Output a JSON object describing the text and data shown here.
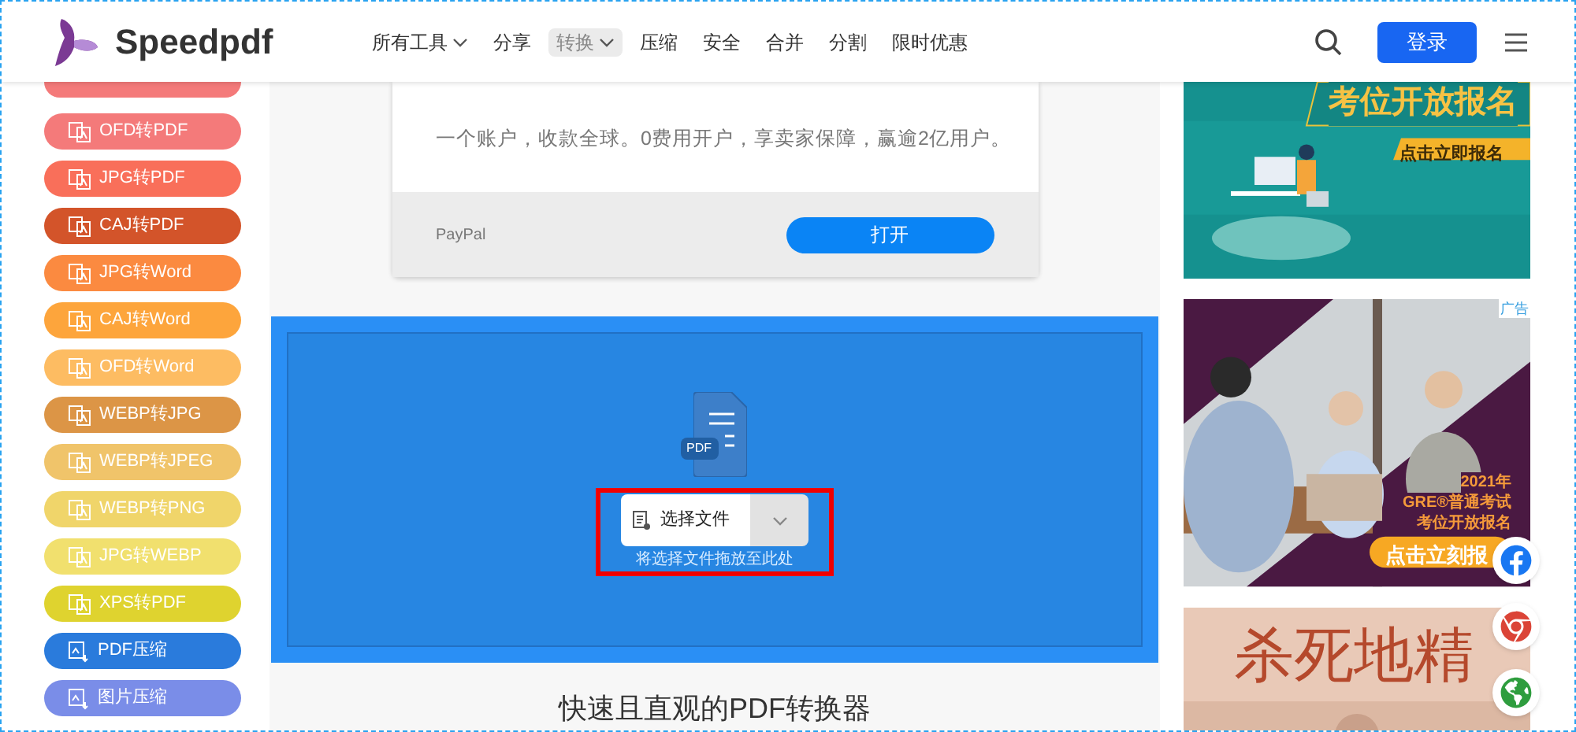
{
  "header": {
    "brand": "Speedpdf",
    "nav": [
      {
        "label": "所有工具",
        "has_menu": true,
        "selected": false
      },
      {
        "label": "分享",
        "has_menu": false,
        "selected": false
      },
      {
        "label": "转换",
        "has_menu": true,
        "selected": true
      },
      {
        "label": "压缩",
        "has_menu": false,
        "selected": false
      },
      {
        "label": "安全",
        "has_menu": false,
        "selected": false
      },
      {
        "label": "合并",
        "has_menu": false,
        "selected": false
      },
      {
        "label": "分割",
        "has_menu": false,
        "selected": false
      },
      {
        "label": "限时优惠",
        "has_menu": false,
        "selected": false
      }
    ],
    "login": "登录"
  },
  "sidebar": {
    "items": [
      {
        "label": "OFD转PDF",
        "color": "#f47a7a",
        "kind": "convert"
      },
      {
        "label": "JPG转PDF",
        "color": "#f96f5a",
        "kind": "convert"
      },
      {
        "label": "CAJ转PDF",
        "color": "#d3542a",
        "kind": "convert"
      },
      {
        "label": "JPG转Word",
        "color": "#fb8a40",
        "kind": "convert"
      },
      {
        "label": "CAJ转Word",
        "color": "#fda53c",
        "kind": "convert"
      },
      {
        "label": "OFD转Word",
        "color": "#fdbc62",
        "kind": "convert"
      },
      {
        "label": "WEBP转JPG",
        "color": "#dc9546",
        "kind": "convert"
      },
      {
        "label": "WEBP转JPEG",
        "color": "#f0c46a",
        "kind": "convert"
      },
      {
        "label": "WEBP转PNG",
        "color": "#f0d56a",
        "kind": "convert"
      },
      {
        "label": "JPG转WEBP",
        "color": "#f1e06e",
        "kind": "convert"
      },
      {
        "label": "XPS转PDF",
        "color": "#dfd32f",
        "kind": "convert"
      },
      {
        "label": "PDF压缩",
        "color": "#2a7bdc",
        "kind": "compress"
      },
      {
        "label": "图片压缩",
        "color": "#7a8de8",
        "kind": "compress"
      }
    ]
  },
  "ad_card": {
    "text": "一个账户，收款全球。0费用开户，享卖家保障，赢逾2亿用户。",
    "source": "PayPal",
    "button": "打开"
  },
  "upload": {
    "file_badge": "PDF",
    "button": "选择文件",
    "hint": "将选择文件拖放至此处"
  },
  "heading": "快速且直观的PDF转换器",
  "banners": [
    {
      "kind": "teal",
      "lines": [
        "考位开放报名"
      ],
      "cta": "点击立即报名"
    },
    {
      "kind": "gre",
      "tag": "广告",
      "lines": [
        "2021年",
        "GRE®普通考试",
        "考位开放报名"
      ],
      "cta": "点击立刻报"
    },
    {
      "kind": "poster",
      "lines": [
        "杀死地精"
      ]
    }
  ]
}
